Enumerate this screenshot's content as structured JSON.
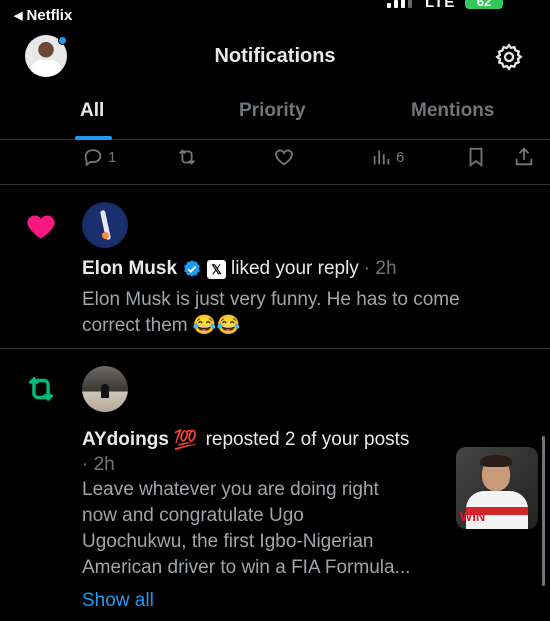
{
  "status_bar": {
    "back_app": "Netflix",
    "network": "LTE",
    "battery": "62"
  },
  "header": {
    "title": "Notifications"
  },
  "tabs": [
    {
      "label": "All",
      "active": true
    },
    {
      "label": "Priority",
      "active": false
    },
    {
      "label": "Mentions",
      "active": false
    }
  ],
  "action_row": {
    "replies": "1",
    "views": "6"
  },
  "notifications": [
    {
      "type": "like",
      "name": "Elon Musk",
      "action": "liked your reply",
      "time": "· 2h",
      "text_line1": "Elon Musk is just very funny. He has to come",
      "text_line2": "correct them",
      "emoji": "😂😂"
    },
    {
      "type": "repost",
      "name": "AYdoings",
      "name_emoji": "💯",
      "action": "reposted 2 of your posts",
      "time": "· 2h",
      "text_lines": [
        "Leave whatever you are doing right",
        "now and congratulate Ugo",
        "Ugochukwu, the first Igbo-Nigerian",
        "American driver to win a FIA Formula..."
      ],
      "show_all": "Show all"
    }
  ],
  "colors": {
    "accent": "#1d9bf0",
    "like": "#f91880",
    "repost": "#00ba7c",
    "muted": "#71767b"
  }
}
